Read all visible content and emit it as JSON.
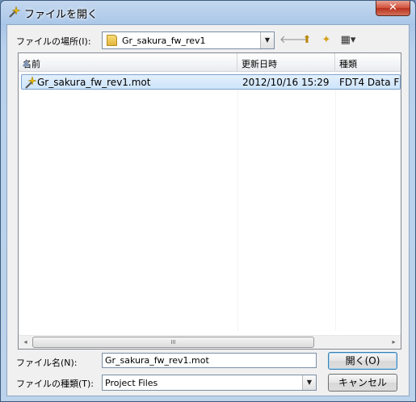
{
  "window": {
    "title": "ファイルを開く",
    "close_label": "✕"
  },
  "lookin": {
    "label": "ファイルの場所(I):",
    "value": "Gr_sakura_fw_rev1"
  },
  "toolbar": {
    "back_glyph": "🡐",
    "up_glyph": "⬆",
    "newfolder_glyph": "✦",
    "view_glyph": "▦▾"
  },
  "columns": [
    {
      "label": "名前"
    },
    {
      "label": "更新日時"
    },
    {
      "label": "種類"
    }
  ],
  "files": [
    {
      "name": "Gr_sakura_fw_rev1.mot",
      "modified": "2012/10/16 15:29",
      "type": "FDT4 Data F"
    }
  ],
  "scrollbar": {
    "left_glyph": "◂",
    "right_glyph": "▸",
    "grip": "III"
  },
  "filename": {
    "label": "ファイル名(N):",
    "value": "Gr_sakura_fw_rev1.mot"
  },
  "filetype": {
    "label": "ファイルの種類(T):",
    "value": "Project Files"
  },
  "buttons": {
    "open": "開く(O)",
    "cancel": "キャンセル"
  },
  "colors": {
    "selection": "#cde4fb",
    "selection_border": "#7da2ce",
    "client": "#f0f0f0"
  }
}
